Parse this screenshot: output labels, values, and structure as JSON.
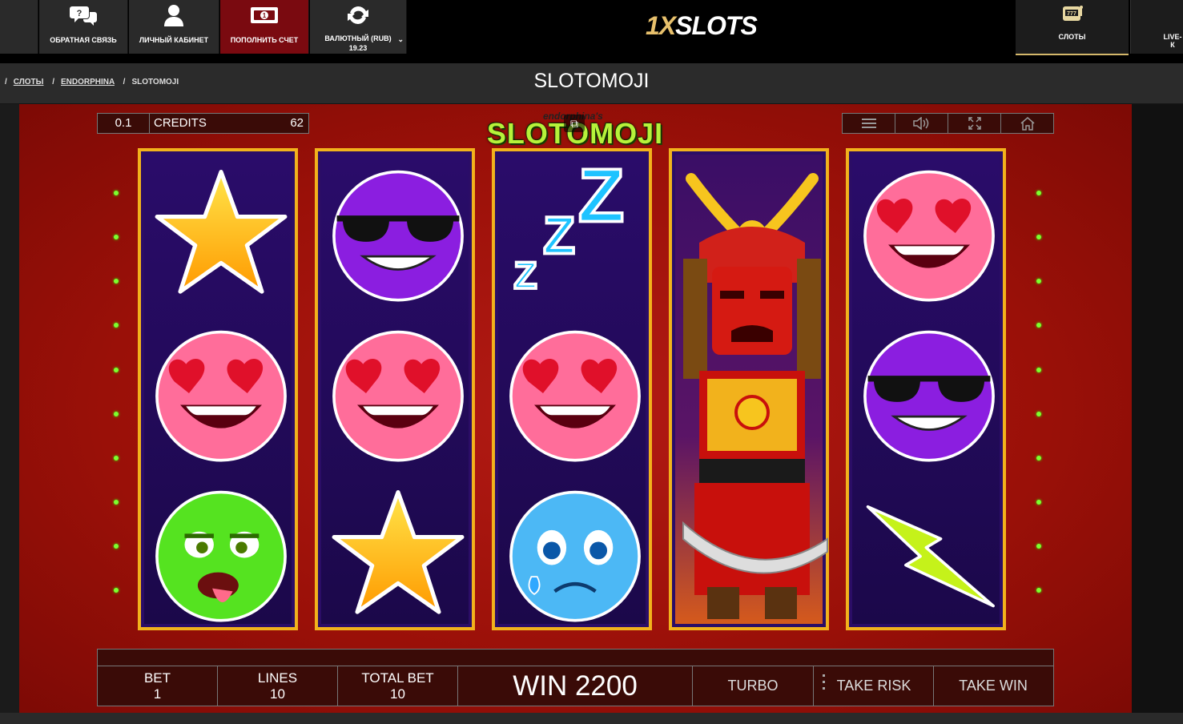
{
  "topbar": {
    "items": [
      {
        "label": "ОБРАТНАЯ СВЯЗЬ",
        "icon": "feedback-icon"
      },
      {
        "label": "ЛИЧНЫЙ КАБИНЕТ",
        "icon": "user-icon"
      },
      {
        "label": "ПОПОЛНИТЬ СЧЕТ",
        "icon": "deposit-icon"
      },
      {
        "label": "ВАЛЮТНЫЙ (RUB)",
        "sub": "19.23",
        "icon": "refresh-icon"
      }
    ],
    "logo": {
      "prefix": "1X",
      "rest": "SLOTS"
    },
    "right": [
      {
        "label": "СЛОТЫ",
        "icon": "slot-machine-icon"
      },
      {
        "label": "LIVE-К"
      }
    ]
  },
  "breadcrumb": [
    {
      "label": "СЛОТЫ"
    },
    {
      "label": "ENDORPHINA"
    },
    {
      "label": "SLOTOMOJI"
    }
  ],
  "game_title": "SLOTOMOJI",
  "game": {
    "logo_sub": "endorphina's",
    "logo_main": "SLOTOMOJI",
    "bet_value": "0.1",
    "credits_label": "CREDITS",
    "credits_value": "62",
    "controls": [
      "menu-icon",
      "sound-icon",
      "fullscreen-icon",
      "home-icon"
    ],
    "reels": [
      [
        "star",
        "heart-eyes",
        "sick"
      ],
      [
        "sunglasses",
        "heart-eyes",
        "star"
      ],
      [
        "zzz",
        "heart-eyes",
        "sad"
      ],
      [
        "samurai",
        "samurai",
        "samurai"
      ],
      [
        "heart-eyes",
        "sunglasses",
        "lightning"
      ]
    ],
    "panel": {
      "bet_label": "BET",
      "bet": "1",
      "lines_label": "LINES",
      "lines": "10",
      "total_bet_label": "TOTAL BET",
      "total_bet": "10",
      "win": "WIN 2200",
      "turbo": "TURBO",
      "take_risk": "TAKE RISK",
      "take_win": "TAKE WIN"
    }
  }
}
